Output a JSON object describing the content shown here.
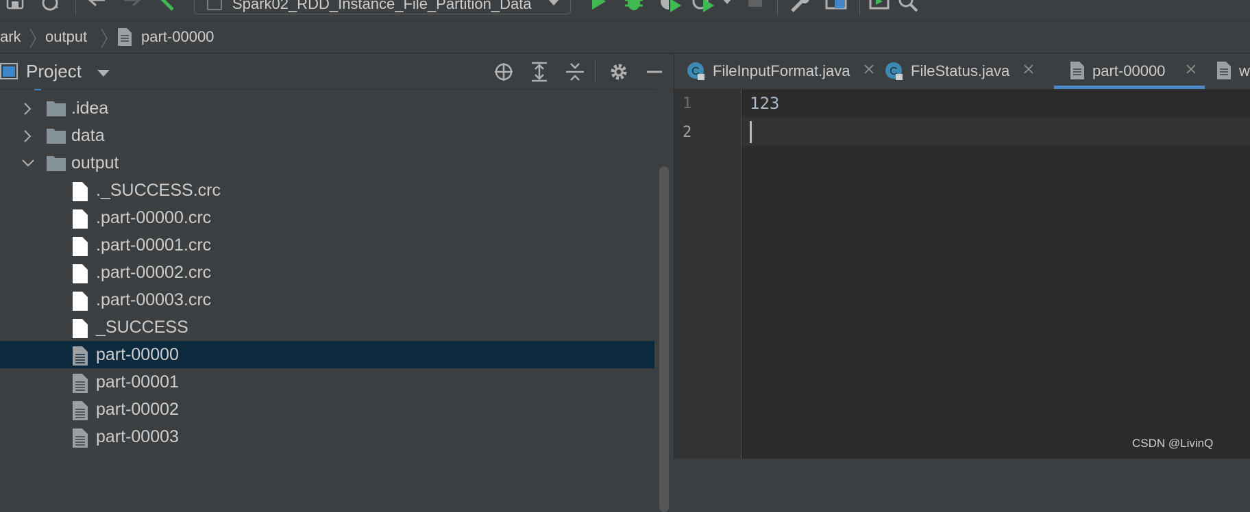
{
  "toolbar": {
    "run_config_label": "Spark02_RDD_Instance_File_Partition_Data",
    "icons": [
      "save-icon",
      "sync-icon",
      "back-icon",
      "forward-icon",
      "build-icon",
      "run-icon",
      "debug-icon",
      "coverage-icon",
      "profile-icon",
      "stop-icon",
      "wrench-icon",
      "structure-icon",
      "run-anything-icon",
      "search-icon"
    ],
    "accent_green": "#3fb950"
  },
  "breadcrumb": {
    "items": [
      "ark",
      "output",
      "part-00000"
    ]
  },
  "project_panel": {
    "title": "Project",
    "tree": [
      {
        "label": ".idea",
        "type": "folder",
        "expanded": false
      },
      {
        "label": "data",
        "type": "folder",
        "expanded": false
      },
      {
        "label": "output",
        "type": "folder",
        "expanded": true
      },
      {
        "label": "._SUCCESS.crc",
        "type": "file"
      },
      {
        "label": ".part-00000.crc",
        "type": "file"
      },
      {
        "label": ".part-00001.crc",
        "type": "file"
      },
      {
        "label": ".part-00002.crc",
        "type": "file"
      },
      {
        "label": ".part-00003.crc",
        "type": "file"
      },
      {
        "label": "_SUCCESS",
        "type": "file"
      },
      {
        "label": "part-00000",
        "type": "text-file",
        "selected": true
      },
      {
        "label": "part-00001",
        "type": "text-file"
      },
      {
        "label": "part-00002",
        "type": "text-file"
      },
      {
        "label": "part-00003",
        "type": "text-file"
      }
    ],
    "selection_color": "#0d293e"
  },
  "editor": {
    "tabs": [
      {
        "label": "FileInputFormat.java",
        "icon": "java-class-locked-icon"
      },
      {
        "label": "FileStatus.java",
        "icon": "java-class-locked-icon"
      },
      {
        "label": "part-00000",
        "icon": "text-file-icon",
        "active": true
      },
      {
        "label": "w",
        "icon": "text-file-icon"
      }
    ],
    "line_numbers": [
      "1",
      "2"
    ],
    "lines": [
      "123",
      ""
    ]
  },
  "watermark": "CSDN @LivinQ"
}
